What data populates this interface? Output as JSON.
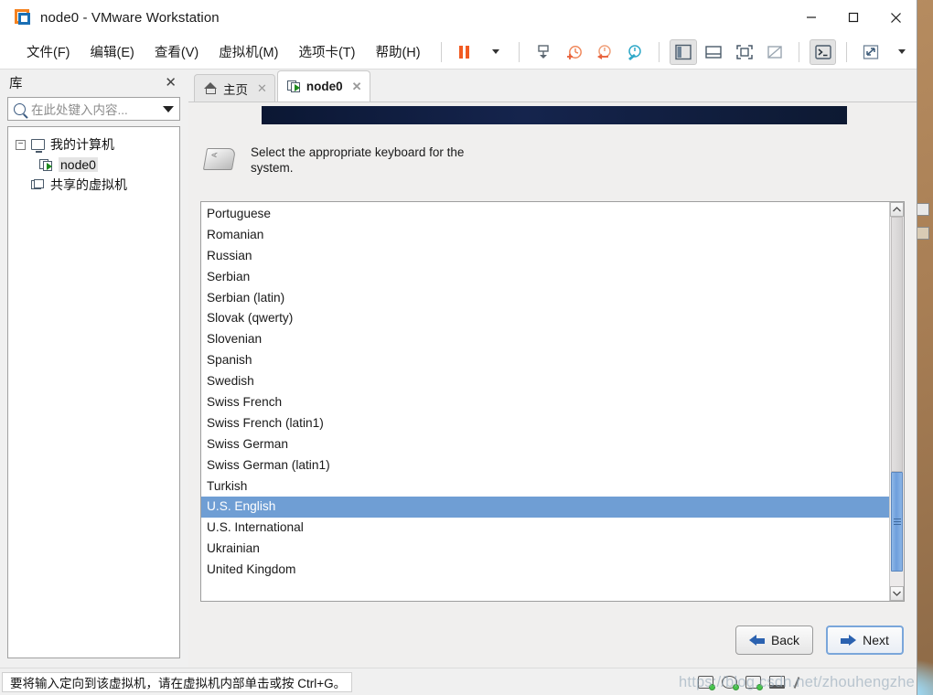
{
  "window": {
    "title": "node0 - VMware Workstation",
    "app_icon": "vmware-logo-icon",
    "controls": {
      "minimize": "—",
      "maximize": "☐",
      "close": "✕"
    }
  },
  "menubar": {
    "items": [
      {
        "label": "文件(F)",
        "name": "menu-file"
      },
      {
        "label": "编辑(E)",
        "name": "menu-edit"
      },
      {
        "label": "查看(V)",
        "name": "menu-view"
      },
      {
        "label": "虚拟机(M)",
        "name": "menu-vm"
      },
      {
        "label": "选项卡(T)",
        "name": "menu-tabs"
      },
      {
        "label": "帮助(H)",
        "name": "menu-help"
      }
    ]
  },
  "toolbar": {
    "buttons": [
      {
        "name": "suspend-button",
        "glyph": "▐▐",
        "title": "suspend"
      },
      {
        "name": "power-dropdown-caret",
        "glyph": "▾",
        "title": "power options"
      },
      {
        "name": "manage-snapshot-button",
        "glyph": "snapshot-icon",
        "title": "snapshot"
      },
      {
        "name": "take-snapshot-button",
        "glyph": "snapshot-add-icon",
        "title": "take snapshot"
      },
      {
        "name": "revert-snapshot-button",
        "glyph": "snapshot-revert-icon",
        "title": "revert snapshot"
      },
      {
        "name": "snapshot-manager-button",
        "glyph": "snapshot-manager-icon",
        "title": "snapshot manager"
      },
      {
        "name": "show-library-button",
        "glyph": "library-panel-icon",
        "title": "show library"
      },
      {
        "name": "show-thumbnail-button",
        "glyph": "thumbnail-bar-icon",
        "title": "thumbnail bar"
      },
      {
        "name": "fullscreen-button",
        "glyph": "fullscreen-icon",
        "title": "enter full screen"
      },
      {
        "name": "unity-button",
        "glyph": "unity-mode-icon",
        "title": "unity mode"
      },
      {
        "name": "console-button",
        "glyph": "console-icon",
        "title": "console view"
      },
      {
        "name": "stretch-button",
        "glyph": "stretch-icon",
        "title": "stretch guest"
      },
      {
        "name": "stretch-dropdown-caret",
        "glyph": "▾",
        "title": "stretch options"
      }
    ]
  },
  "library": {
    "title": "库",
    "close_label": "✕",
    "search_placeholder": "在此处键入内容...",
    "search_value": "",
    "tree": [
      {
        "label": "我的计算机",
        "name": "tree-item-my-computer",
        "icon": "monitor-icon",
        "expanded": true,
        "level": 0
      },
      {
        "label": "node0",
        "name": "tree-item-node0",
        "icon": "virtual-machine-icon",
        "selected": true,
        "level": 1
      },
      {
        "label": "共享的虚拟机",
        "name": "tree-item-shared-vms",
        "icon": "shared-vms-icon",
        "level": 0
      }
    ]
  },
  "tabs": [
    {
      "label": "主页",
      "name": "tab-home",
      "icon": "home-icon",
      "active": false,
      "close": "✕"
    },
    {
      "label": "node0",
      "name": "tab-node0",
      "icon": "virtual-machine-icon",
      "active": true,
      "close": "✕"
    }
  ],
  "installer": {
    "help_text": "Select the appropriate keyboard for the system.",
    "help_icon": "keyboard-key-icon",
    "banner_color": "#12204a",
    "selection_color": "#6f9ed4",
    "keyboard_list": [
      {
        "label": "Portuguese",
        "selected": false
      },
      {
        "label": "Romanian",
        "selected": false
      },
      {
        "label": "Russian",
        "selected": false
      },
      {
        "label": "Serbian",
        "selected": false
      },
      {
        "label": "Serbian (latin)",
        "selected": false
      },
      {
        "label": "Slovak (qwerty)",
        "selected": false
      },
      {
        "label": "Slovenian",
        "selected": false
      },
      {
        "label": "Spanish",
        "selected": false
      },
      {
        "label": "Swedish",
        "selected": false
      },
      {
        "label": "Swiss French",
        "selected": false
      },
      {
        "label": "Swiss French (latin1)",
        "selected": false
      },
      {
        "label": "Swiss German",
        "selected": false
      },
      {
        "label": "Swiss German (latin1)",
        "selected": false
      },
      {
        "label": "Turkish",
        "selected": false
      },
      {
        "label": "U.S. English",
        "selected": true
      },
      {
        "label": "U.S. International",
        "selected": false
      },
      {
        "label": "Ukrainian",
        "selected": false
      },
      {
        "label": "United Kingdom",
        "selected": false
      }
    ],
    "scrollbar": {
      "up_arrow": "▲",
      "down_arrow": "▼",
      "thumb_position_percent": 69
    },
    "buttons": {
      "back": "Back",
      "next": "Next"
    }
  },
  "statusbar": {
    "message": "要将输入定向到该虚拟机，请在虚拟机内部单击或按 Ctrl+G。",
    "device_icons": [
      {
        "name": "hard-disk-icon"
      },
      {
        "name": "cd-dvd-icon"
      },
      {
        "name": "network-adapter-icon"
      },
      {
        "name": "printer-icon"
      },
      {
        "name": "usb-device-icon"
      }
    ],
    "watermark": "https://blog.csdn.net/zhouhengzhe"
  }
}
